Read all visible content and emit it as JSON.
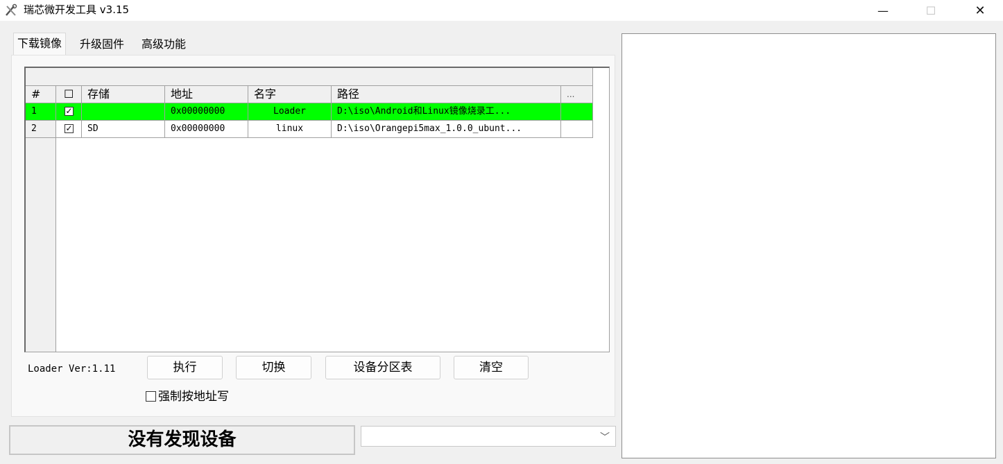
{
  "window": {
    "title": "瑞芯微开发工具 v3.15",
    "minimize_glyph": "—",
    "maximize_glyph": "☐",
    "close_glyph": "✕"
  },
  "tabs": [
    {
      "label": "下载镜像",
      "active": true
    },
    {
      "label": "升级固件",
      "active": false
    },
    {
      "label": "高级功能",
      "active": false
    }
  ],
  "table": {
    "columns": [
      "#",
      "☐",
      "存储",
      "地址",
      "名字",
      "路径",
      "..."
    ],
    "rows": [
      {
        "num": "1",
        "checked": "✓",
        "storage": "",
        "address": "0x00000000",
        "name": "Loader",
        "path": "D:\\iso\\Android和Linux镜像烧录工...",
        "selected": true
      },
      {
        "num": "2",
        "checked": "✓",
        "storage": "SD",
        "address": "0x00000000",
        "name": "linux",
        "path": "D:\\iso\\Orangepi5max_1.0.0_ubunt...",
        "selected": false
      }
    ]
  },
  "loader_version": "Loader Ver:1.11",
  "buttons": {
    "execute": "执行",
    "switch": "切换",
    "partition_table": "设备分区表",
    "clear": "清空"
  },
  "force_write": {
    "label": "强制按地址写",
    "checked": false
  },
  "status": {
    "text": "没有发现设备"
  },
  "device_dropdown": {
    "value": "",
    "arrow": "﹀"
  },
  "colors": {
    "selected_row": "#00ff00"
  },
  "icons": {
    "app": "tools-icon",
    "checkbox": "checkbox-icon",
    "dropdown": "chevron-down-icon"
  }
}
